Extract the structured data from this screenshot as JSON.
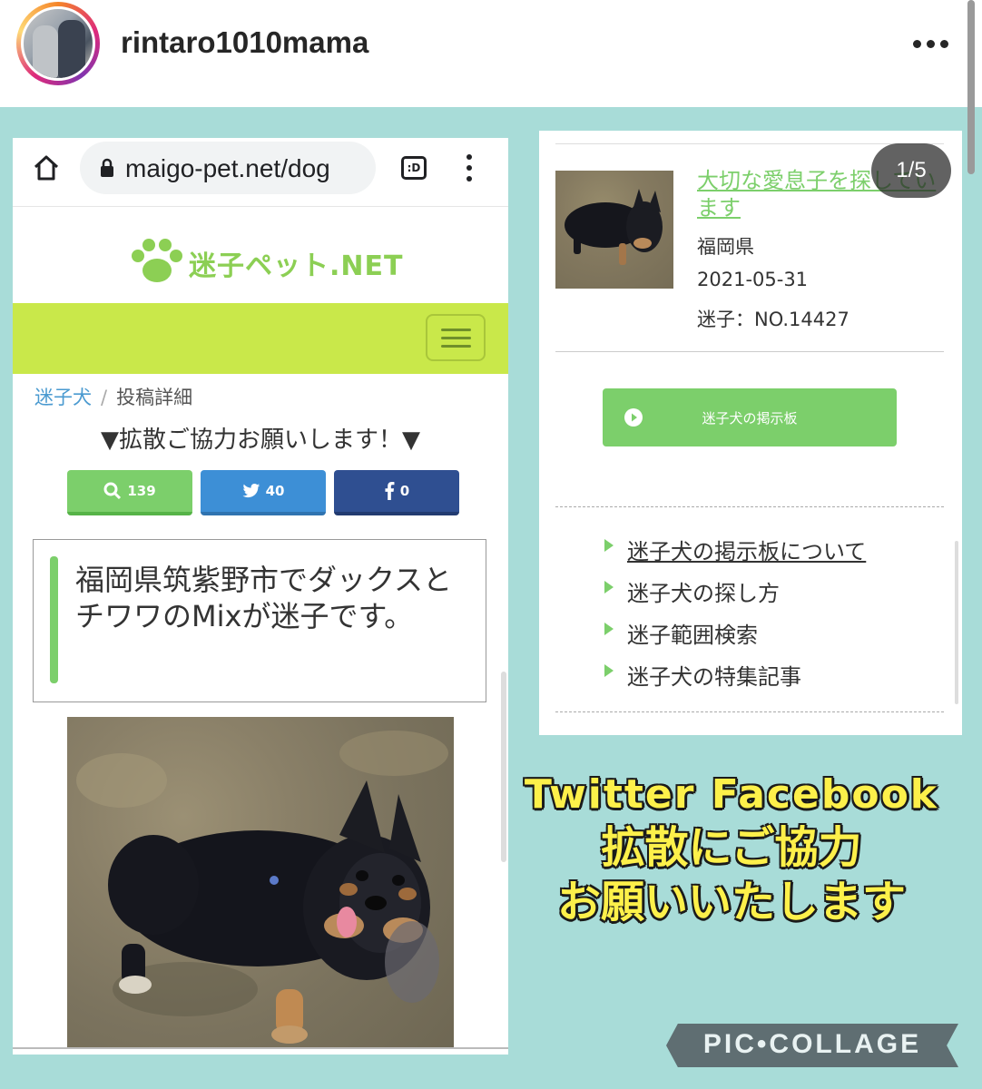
{
  "post": {
    "username": "rintaro1010mama",
    "page_counter": "1/5"
  },
  "left_screenshot": {
    "url": "maigo-pet.net/dog",
    "tabs_label": ":D",
    "site_name": "迷子ペット.NET",
    "breadcrumb": [
      "迷子犬",
      "投稿詳細"
    ],
    "breadcrumb_sep": "/",
    "spread_heading": "▼拡散ご協力お願いします！▼",
    "share_buttons": [
      {
        "label": "139",
        "icon": "search-icon"
      },
      {
        "label": "40",
        "icon": "twitter-icon"
      },
      {
        "label": "0",
        "icon": "facebook-icon"
      }
    ],
    "post_title": "福岡県筑紫野市でダックスとチワワのMixが迷子です。"
  },
  "right_screenshot": {
    "post_link": "大切な愛息子を探しています",
    "prefecture": "福岡県",
    "date": "2021-05-31",
    "post_number": "迷子：NO.14427",
    "board_button": "迷子犬の掲示板",
    "menu_items": [
      "迷子犬の掲示板について",
      "迷子犬の探し方",
      "迷子範囲検索",
      "迷子犬の特集記事"
    ]
  },
  "caption": {
    "line1": "Twitter Facebook",
    "line2": "拡散にご協力",
    "line3": "お願いいたします"
  },
  "watermark": "PIC•COLLAGE",
  "colors": {
    "accent_green": "#7ccf6b",
    "nav_lime": "#c9e84a",
    "twitter_blue": "#3d8fd6",
    "facebook_navy": "#2f4f91",
    "collage_bg": "#a8dcd8",
    "caption_yellow": "#fdf04a"
  }
}
